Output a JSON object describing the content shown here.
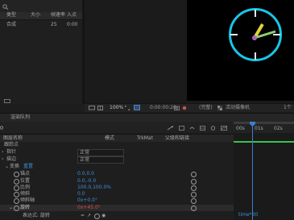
{
  "project": {
    "search_icon": "search-icon",
    "columns": [
      "类型",
      "大小",
      "帧速率",
      "入点"
    ],
    "row": {
      "type": "合成",
      "rate": "25",
      "in": "0:00"
    }
  },
  "viewer": {
    "zoom": "100%",
    "timecode": "0:00:00:20",
    "view_mode": "(完整)",
    "camera": "活动摄像机",
    "views": "1个"
  },
  "timeline": {
    "tab": "渲染队列",
    "columns": {
      "layer_name": "图层名称",
      "mode": "模式",
      "trkmat": "TrkMat",
      "parent": "父级和链接"
    },
    "layers": [
      {
        "name": "跟踪点",
        "mode": ""
      },
      {
        "name": "指针",
        "mode": "正常"
      },
      {
        "name": "描边",
        "mode": "正常"
      }
    ],
    "transform": {
      "label": "变换",
      "reset": "重置"
    },
    "properties": [
      {
        "name": "锚点",
        "value": "0.0,0.0"
      },
      {
        "name": "位置",
        "value": "0.0,-0.0"
      },
      {
        "name": "比例",
        "value": "100.0,100.0%"
      },
      {
        "name": "倾斜",
        "value": "0.0"
      },
      {
        "name": "倾斜轴",
        "value": "0x+0.0°"
      },
      {
        "name": "旋转",
        "value": "0x+45.0°"
      }
    ],
    "expression_label": "表达式: 旋转",
    "expression_text": "time*30",
    "ruler_ticks": [
      "00s",
      "01s",
      "02s"
    ]
  },
  "colors": {
    "accent": "#3d8ed8",
    "clock": "#18c6e8",
    "hand_yellow": "#e4d23a",
    "hand_green": "#8fd16f",
    "key": "#e0484d"
  }
}
